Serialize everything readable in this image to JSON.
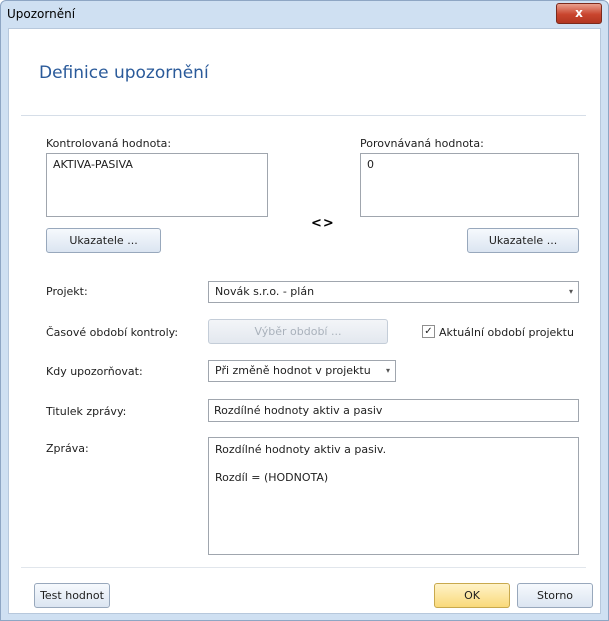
{
  "window": {
    "title": "Upozornění",
    "close_glyph": "x"
  },
  "header": {
    "title": "Definice upozornění"
  },
  "checked": {
    "label": "Kontrolovaná hodnota:",
    "value": "AKTIVA-PASIVA",
    "button": "Ukazatele ..."
  },
  "operator": "<>",
  "compared": {
    "label": "Porovnávaná hodnota:",
    "value": "0",
    "button": "Ukazatele ..."
  },
  "project": {
    "label": "Projekt:",
    "value": "Novák s.r.o. - plán"
  },
  "period": {
    "label": "Časové období kontroly:",
    "button": "Výběr období ...",
    "checkbox_label": "Aktuální období projektu",
    "checkbox_checked": true
  },
  "when": {
    "label": "Kdy upozorňovat:",
    "value": "Při změně hodnot v projektu"
  },
  "subject": {
    "label": "Titulek zprávy:",
    "value": "Rozdílné hodnoty aktiv a pasiv"
  },
  "message": {
    "label": "Zpráva:",
    "value": "Rozdílné hodnoty aktiv a pasiv.\n\nRozdíl = (HODNOTA)"
  },
  "footer": {
    "test_button": "Test hodnot",
    "ok_button": "OK",
    "cancel_button": "Storno"
  }
}
